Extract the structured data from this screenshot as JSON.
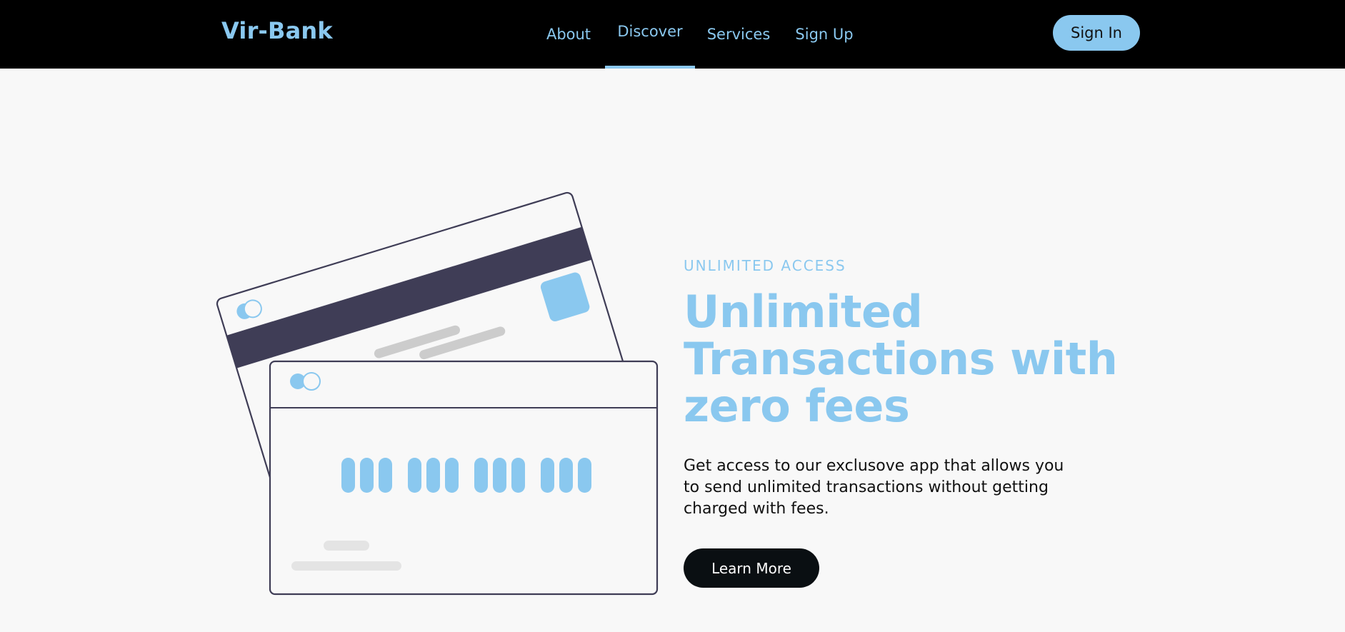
{
  "nav": {
    "logo": "Vir-Bank",
    "items": [
      {
        "label": "About"
      },
      {
        "label": "Discover",
        "active": true
      },
      {
        "label": "Services"
      },
      {
        "label": "Sign Up"
      }
    ],
    "signin_label": "Sign In"
  },
  "hero": {
    "eyebrow": "UNLIMITED ACCESS",
    "headline_lines": [
      "Unlimited",
      "Transactions with",
      "zero fees"
    ],
    "description": "Get access to our exclusove app that allows you to send unlimited transactions without getting charged with fees.",
    "cta_label": "Learn More"
  },
  "illustration": {
    "icon": "credit-cards-illustration"
  },
  "colors": {
    "accent": "#8ac8ef",
    "nav_bg": "#000000",
    "page_bg": "#f8f8f8",
    "text_dark": "#111111",
    "card_stripe": "#3f3d56",
    "cta_bg": "#0a0f12"
  }
}
